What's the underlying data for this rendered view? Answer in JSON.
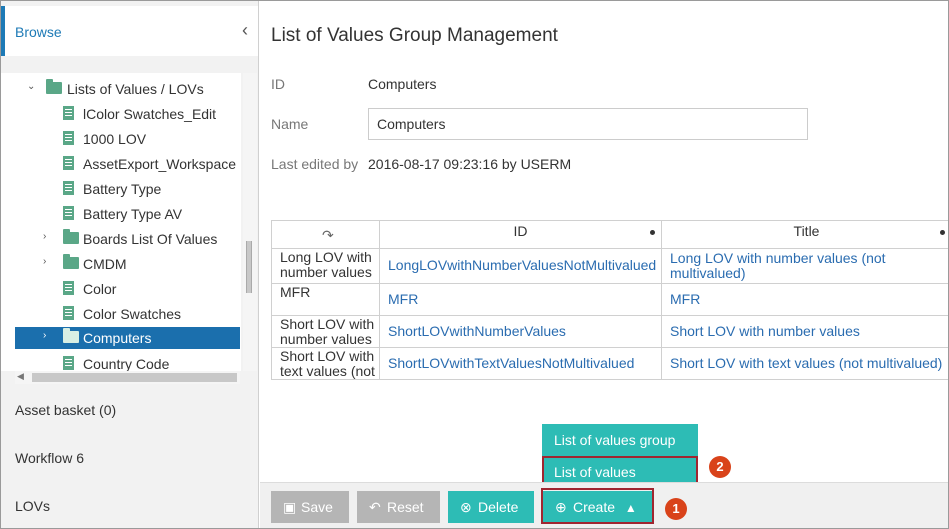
{
  "sidebar": {
    "header_title": "Browse",
    "collapse_icon": "chevron-left-icon",
    "tree": [
      {
        "label": "Lists of Values / LOVs",
        "type": "folder",
        "expanded": true
      },
      {
        "label": "lColor Swatches_Edit",
        "type": "doc"
      },
      {
        "label": "1000 LOV",
        "type": "doc"
      },
      {
        "label": "AssetExport_Workspace",
        "type": "doc"
      },
      {
        "label": "Battery Type",
        "type": "doc"
      },
      {
        "label": "Battery Type AV",
        "type": "doc"
      },
      {
        "label": "Boards List Of Values",
        "type": "folder",
        "expanded": false
      },
      {
        "label": "CMDM",
        "type": "folder",
        "expanded": false
      },
      {
        "label": "Color",
        "type": "doc"
      },
      {
        "label": "Color Swatches",
        "type": "doc"
      },
      {
        "label": "Computers",
        "type": "folder",
        "expanded": false,
        "selected": true
      },
      {
        "label": "Country Code",
        "type": "doc"
      }
    ],
    "sections": [
      "Asset basket (0)",
      "Workflow 6",
      "LOVs"
    ]
  },
  "main": {
    "title": "List of Values Group Management",
    "fields": {
      "id_label": "ID",
      "id_value": "Computers",
      "name_label": "Name",
      "name_value": "Computers",
      "edited_label": "Last edited by",
      "edited_value": "2016-08-17 09:23:16 by USERM"
    },
    "table": {
      "columns": [
        "ID",
        "Title"
      ],
      "rows": [
        {
          "rowhead": "Long LOV with number values",
          "id": "LongLOVwithNumberValuesNotMultivalued",
          "title": "Long LOV with number values (not multivalued)"
        },
        {
          "rowhead": "MFR",
          "id": "MFR",
          "title": "MFR"
        },
        {
          "rowhead": "Short LOV with number values",
          "id": "ShortLOVwithNumberValues",
          "title": "Short LOV with number values"
        },
        {
          "rowhead": "Short LOV with text values (not",
          "id": "ShortLOVwithTextValuesNotMultivalued",
          "title": "Short LOV with text values (not multivalued)"
        }
      ]
    }
  },
  "toolbar": {
    "save": "Save",
    "reset": "Reset",
    "delete": "Delete",
    "create": "Create"
  },
  "create_menu": {
    "items": [
      "List of values group",
      "List of values"
    ]
  },
  "annotations": {
    "badge1": "1",
    "badge2": "2"
  },
  "colors": {
    "accent": "#1d7ab6",
    "teal": "#2dbcb5",
    "highlight": "#a02630",
    "badge": "#d9431a"
  }
}
